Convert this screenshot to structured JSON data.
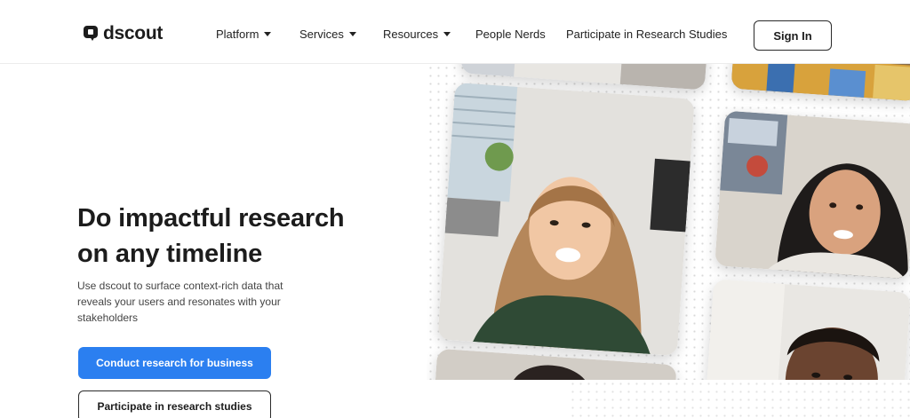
{
  "brand": {
    "name": "dscout"
  },
  "nav": {
    "items": [
      {
        "label": "Platform",
        "has_dropdown": true
      },
      {
        "label": "Services",
        "has_dropdown": true
      },
      {
        "label": "Resources",
        "has_dropdown": true
      },
      {
        "label": "People Nerds",
        "has_dropdown": false
      },
      {
        "label": "Participate in Research Studies",
        "has_dropdown": false
      }
    ],
    "sign_in": "Sign In"
  },
  "hero": {
    "title_line1": "Do impactful research",
    "title_line2": "on any timeline",
    "subtitle": "Use dscout to surface context-rich data that reveals your users and resonates with your stakeholders",
    "primary_cta": "Conduct research for business",
    "secondary_cta": "Participate in research studies"
  },
  "colors": {
    "accent": "#2b7ff0",
    "text": "#1c1c1c",
    "border": "#2a2a2a"
  },
  "icons": [
    "dscout-logo-icon",
    "chevron-down-icon"
  ]
}
